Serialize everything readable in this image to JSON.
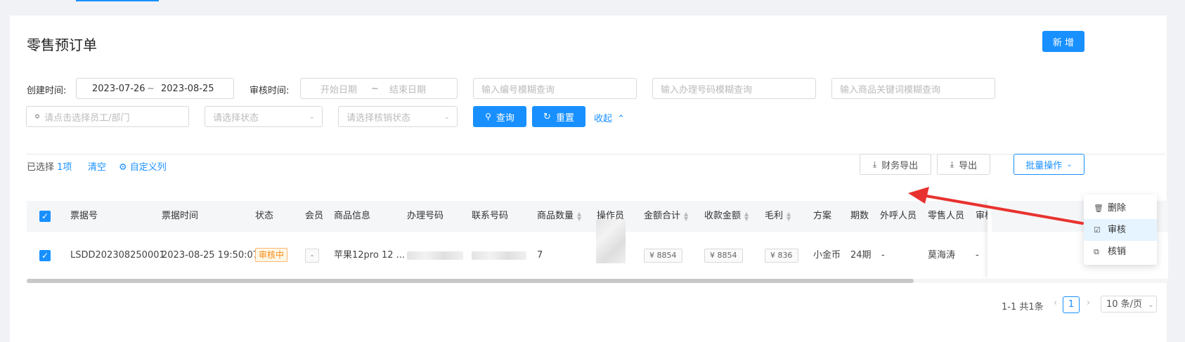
{
  "page": {
    "title": "零售预订单",
    "add_label": "新 增"
  },
  "filters": {
    "create_time_label": "创建时间:",
    "create_start": "2023-07-26",
    "create_sep": "~",
    "create_end": "2023-08-25",
    "audit_time_label": "审核时间:",
    "audit_start_placeholder": "开始日期",
    "audit_sep": "~",
    "audit_end_placeholder": "结束日期",
    "code_placeholder": "输入编号模糊查询",
    "phone_placeholder": "输入办理号码模糊查询",
    "product_placeholder": "输入商品关键词模糊查询",
    "staff_placeholder": "请点击选择员工/部门",
    "status_placeholder": "请选择状态",
    "writeoff_placeholder": "请选择核销状态",
    "query_label": "查询",
    "reset_label": "重置",
    "collapse_label": "收起"
  },
  "toolbar": {
    "selected_prefix": "已选择",
    "selected_count": "1项",
    "clear_label": "清空",
    "custom_columns_label": "自定义列",
    "finance_export_label": "财务导出",
    "export_label": "导出",
    "batch_label": "批量操作"
  },
  "table": {
    "headers": [
      "票据号",
      "票据时间",
      "状态",
      "会员",
      "商品信息",
      "办理号码",
      "联系号码",
      "商品数量",
      "操作员",
      "金额合计",
      "收款金额",
      "毛利",
      "方案",
      "期数",
      "外呼人员",
      "零售人员",
      "审核"
    ],
    "rows": [
      {
        "bill_no": "LSDD202308250001",
        "bill_time": "2023-08-25 19:50:07",
        "status": "审核中",
        "member": "-",
        "product": "苹果12pro 12 ...",
        "qty": "7",
        "amount_total": "¥ 8854",
        "received": "¥ 8854",
        "profit": "¥ 836",
        "plan": "小金币",
        "periods": "24期",
        "caller": "-",
        "retail_staff": "莫海涛",
        "auditor": "-"
      }
    ]
  },
  "batch_menu": {
    "items": [
      "删除",
      "审核",
      "核销"
    ]
  },
  "pagination": {
    "summary": "1-1 共1条",
    "current_page": "1",
    "page_size": "10 条/页"
  },
  "colors": {
    "primary": "#1890ff",
    "warning": "#fa8c16",
    "arrow": "#e8322f"
  }
}
